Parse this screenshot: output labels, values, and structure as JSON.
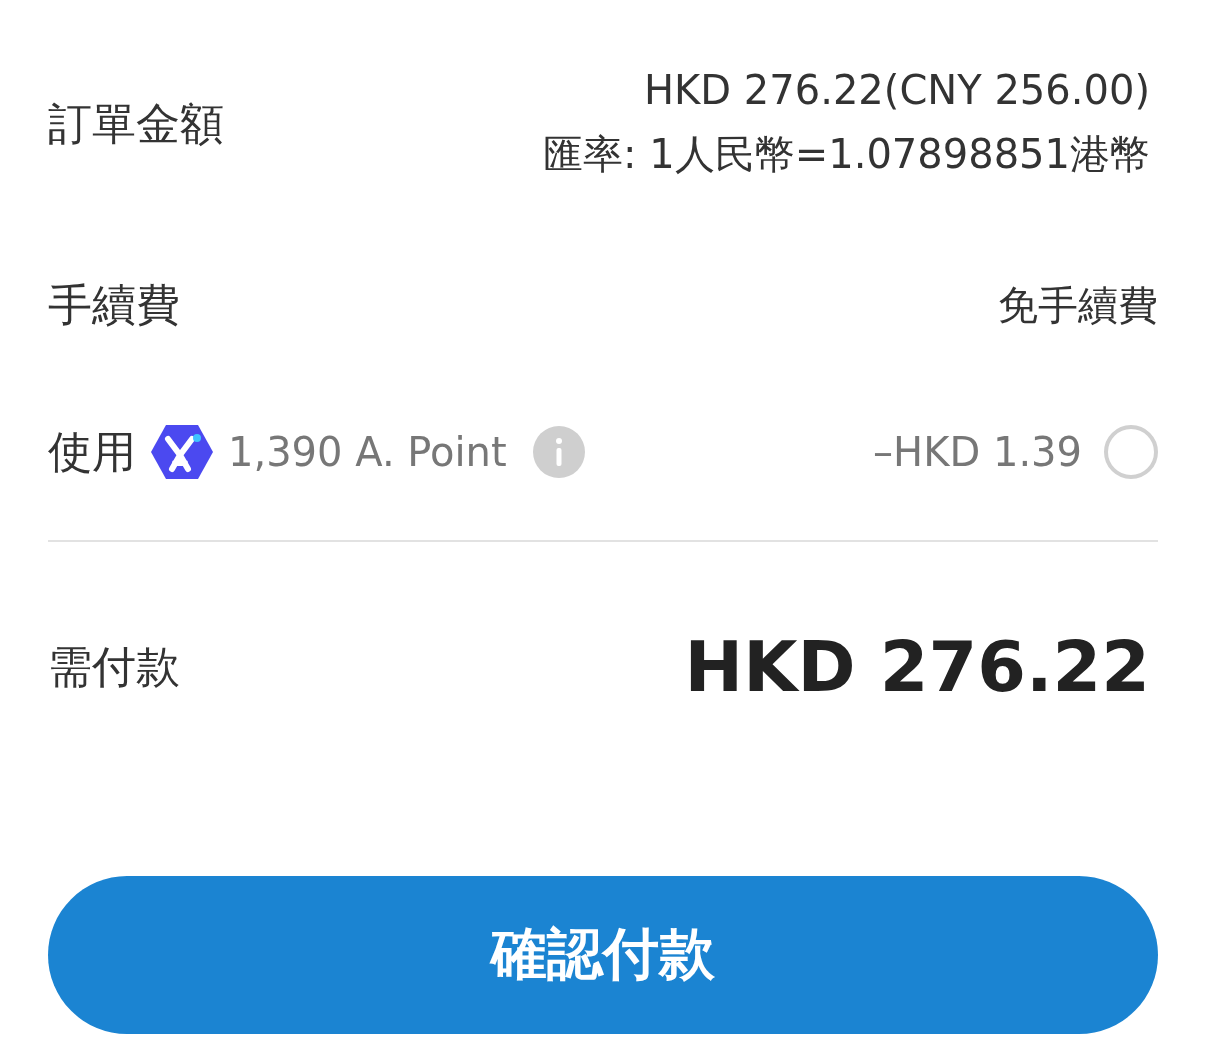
{
  "order_amount": {
    "label": "訂單金額",
    "amount": "HKD 276.22(CNY 256.00)",
    "rate": "匯率: 1人民幣=1.07898851港幣"
  },
  "fee": {
    "label": "手續費",
    "value": "免手續費"
  },
  "points": {
    "label": "使用",
    "points": "1,390 A. Point",
    "deduction": "–HKD 1.39",
    "checked": false
  },
  "total": {
    "label": "需付款",
    "amount": "HKD 276.22"
  },
  "confirm_button": "確認付款"
}
